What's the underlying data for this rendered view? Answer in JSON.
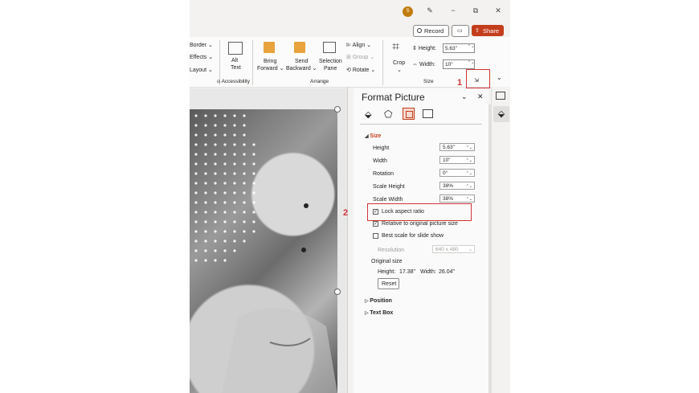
{
  "titlebar": {
    "avatar": "S",
    "pen": "✎",
    "minimize": "−",
    "restore": "⧉",
    "close": "✕"
  },
  "top_buttons": {
    "record": "Record",
    "comment": "▭",
    "share": "Share"
  },
  "ribbon": {
    "picture_styles": [
      "Border ⌄",
      "Effects ⌄",
      "Layout ⌄"
    ],
    "alt_text": [
      "Alt",
      "Text"
    ],
    "bring_forward": [
      "Bring",
      "Forward ⌄"
    ],
    "send_backward": [
      "Send",
      "Backward ⌄"
    ],
    "selection_pane": [
      "Selection",
      "Pane"
    ],
    "align": "Align ⌄",
    "group": "Group ⌄",
    "rotate": "Rotate ⌄",
    "crop": "Crop",
    "height_label": "Height:",
    "height_value": "5.63\"",
    "width_label": "Width:",
    "width_value": "10\"",
    "groups": {
      "accessibility": "Accessibility",
      "arrange": "Arrange",
      "size": "Size"
    },
    "collapse": "⌄",
    "launcher": "⇲"
  },
  "annotations": {
    "one": "1",
    "two": "2"
  },
  "pane": {
    "title": "Format Picture",
    "dropdown": "⌄",
    "close": "✕",
    "sections": {
      "size": "Size",
      "position": "Position",
      "text_box": "Text Box"
    },
    "size_rows": [
      {
        "label": "Height",
        "value": "5.63\""
      },
      {
        "label": "Width",
        "value": "10\""
      },
      {
        "label": "Rotation",
        "value": "0°"
      },
      {
        "label": "Scale Height",
        "value": "38%"
      },
      {
        "label": "Scale Width",
        "value": "38%"
      }
    ],
    "checkboxes": {
      "lock": "Lock aspect ratio",
      "relative": "Relative to original picture size",
      "best_scale": "Best scale for slide show"
    },
    "resolution_label": "Resolution",
    "resolution_value": "640 x 480",
    "original_size": "Original size",
    "orig_height_label": "Height:",
    "orig_height": "17.38\"",
    "orig_width_label": "Width:",
    "orig_width": "26.04\"",
    "reset": "Reset"
  },
  "colors": {
    "accent": "#c43e1c",
    "annotation": "#d13438",
    "icon_orange": "#e8a33d"
  }
}
